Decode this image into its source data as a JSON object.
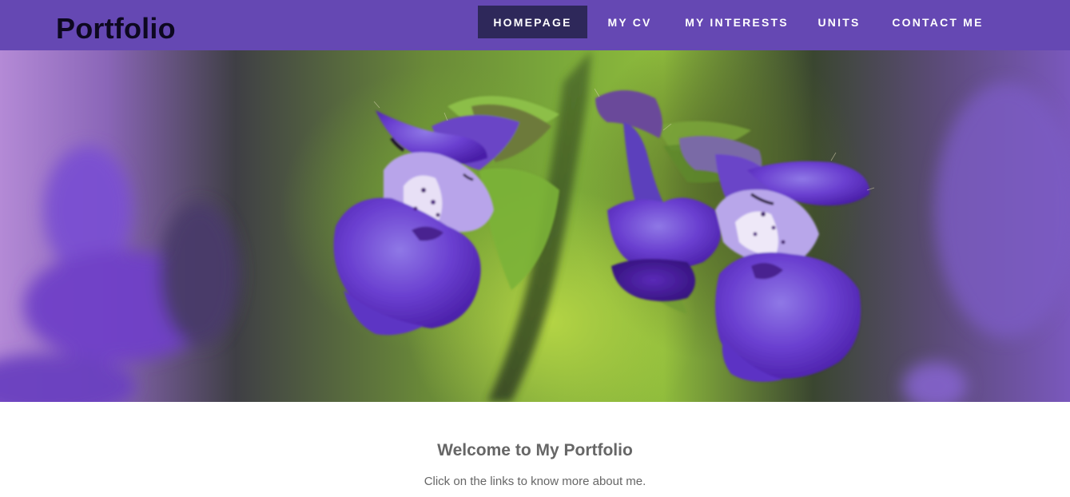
{
  "header": {
    "brand": "Portfolio",
    "nav": [
      {
        "label": "HOMEPAGE",
        "active": true
      },
      {
        "label": "MY CV",
        "active": false
      },
      {
        "label": "MY INTERESTS",
        "active": false
      },
      {
        "label": "UNITS",
        "active": false
      },
      {
        "label": "CONTACT ME",
        "active": false
      }
    ]
  },
  "hero": {
    "image": "purple-catmint-flowers-photo"
  },
  "main": {
    "title": "Welcome to My Portfolio",
    "subtitle": "Click on the links to know more about me."
  },
  "colors": {
    "header_bg": "#6548b3",
    "nav_active_bg": "#2e285a",
    "nav_text": "#ffffff",
    "brand_text": "#0d0820",
    "body_text": "#666666"
  }
}
